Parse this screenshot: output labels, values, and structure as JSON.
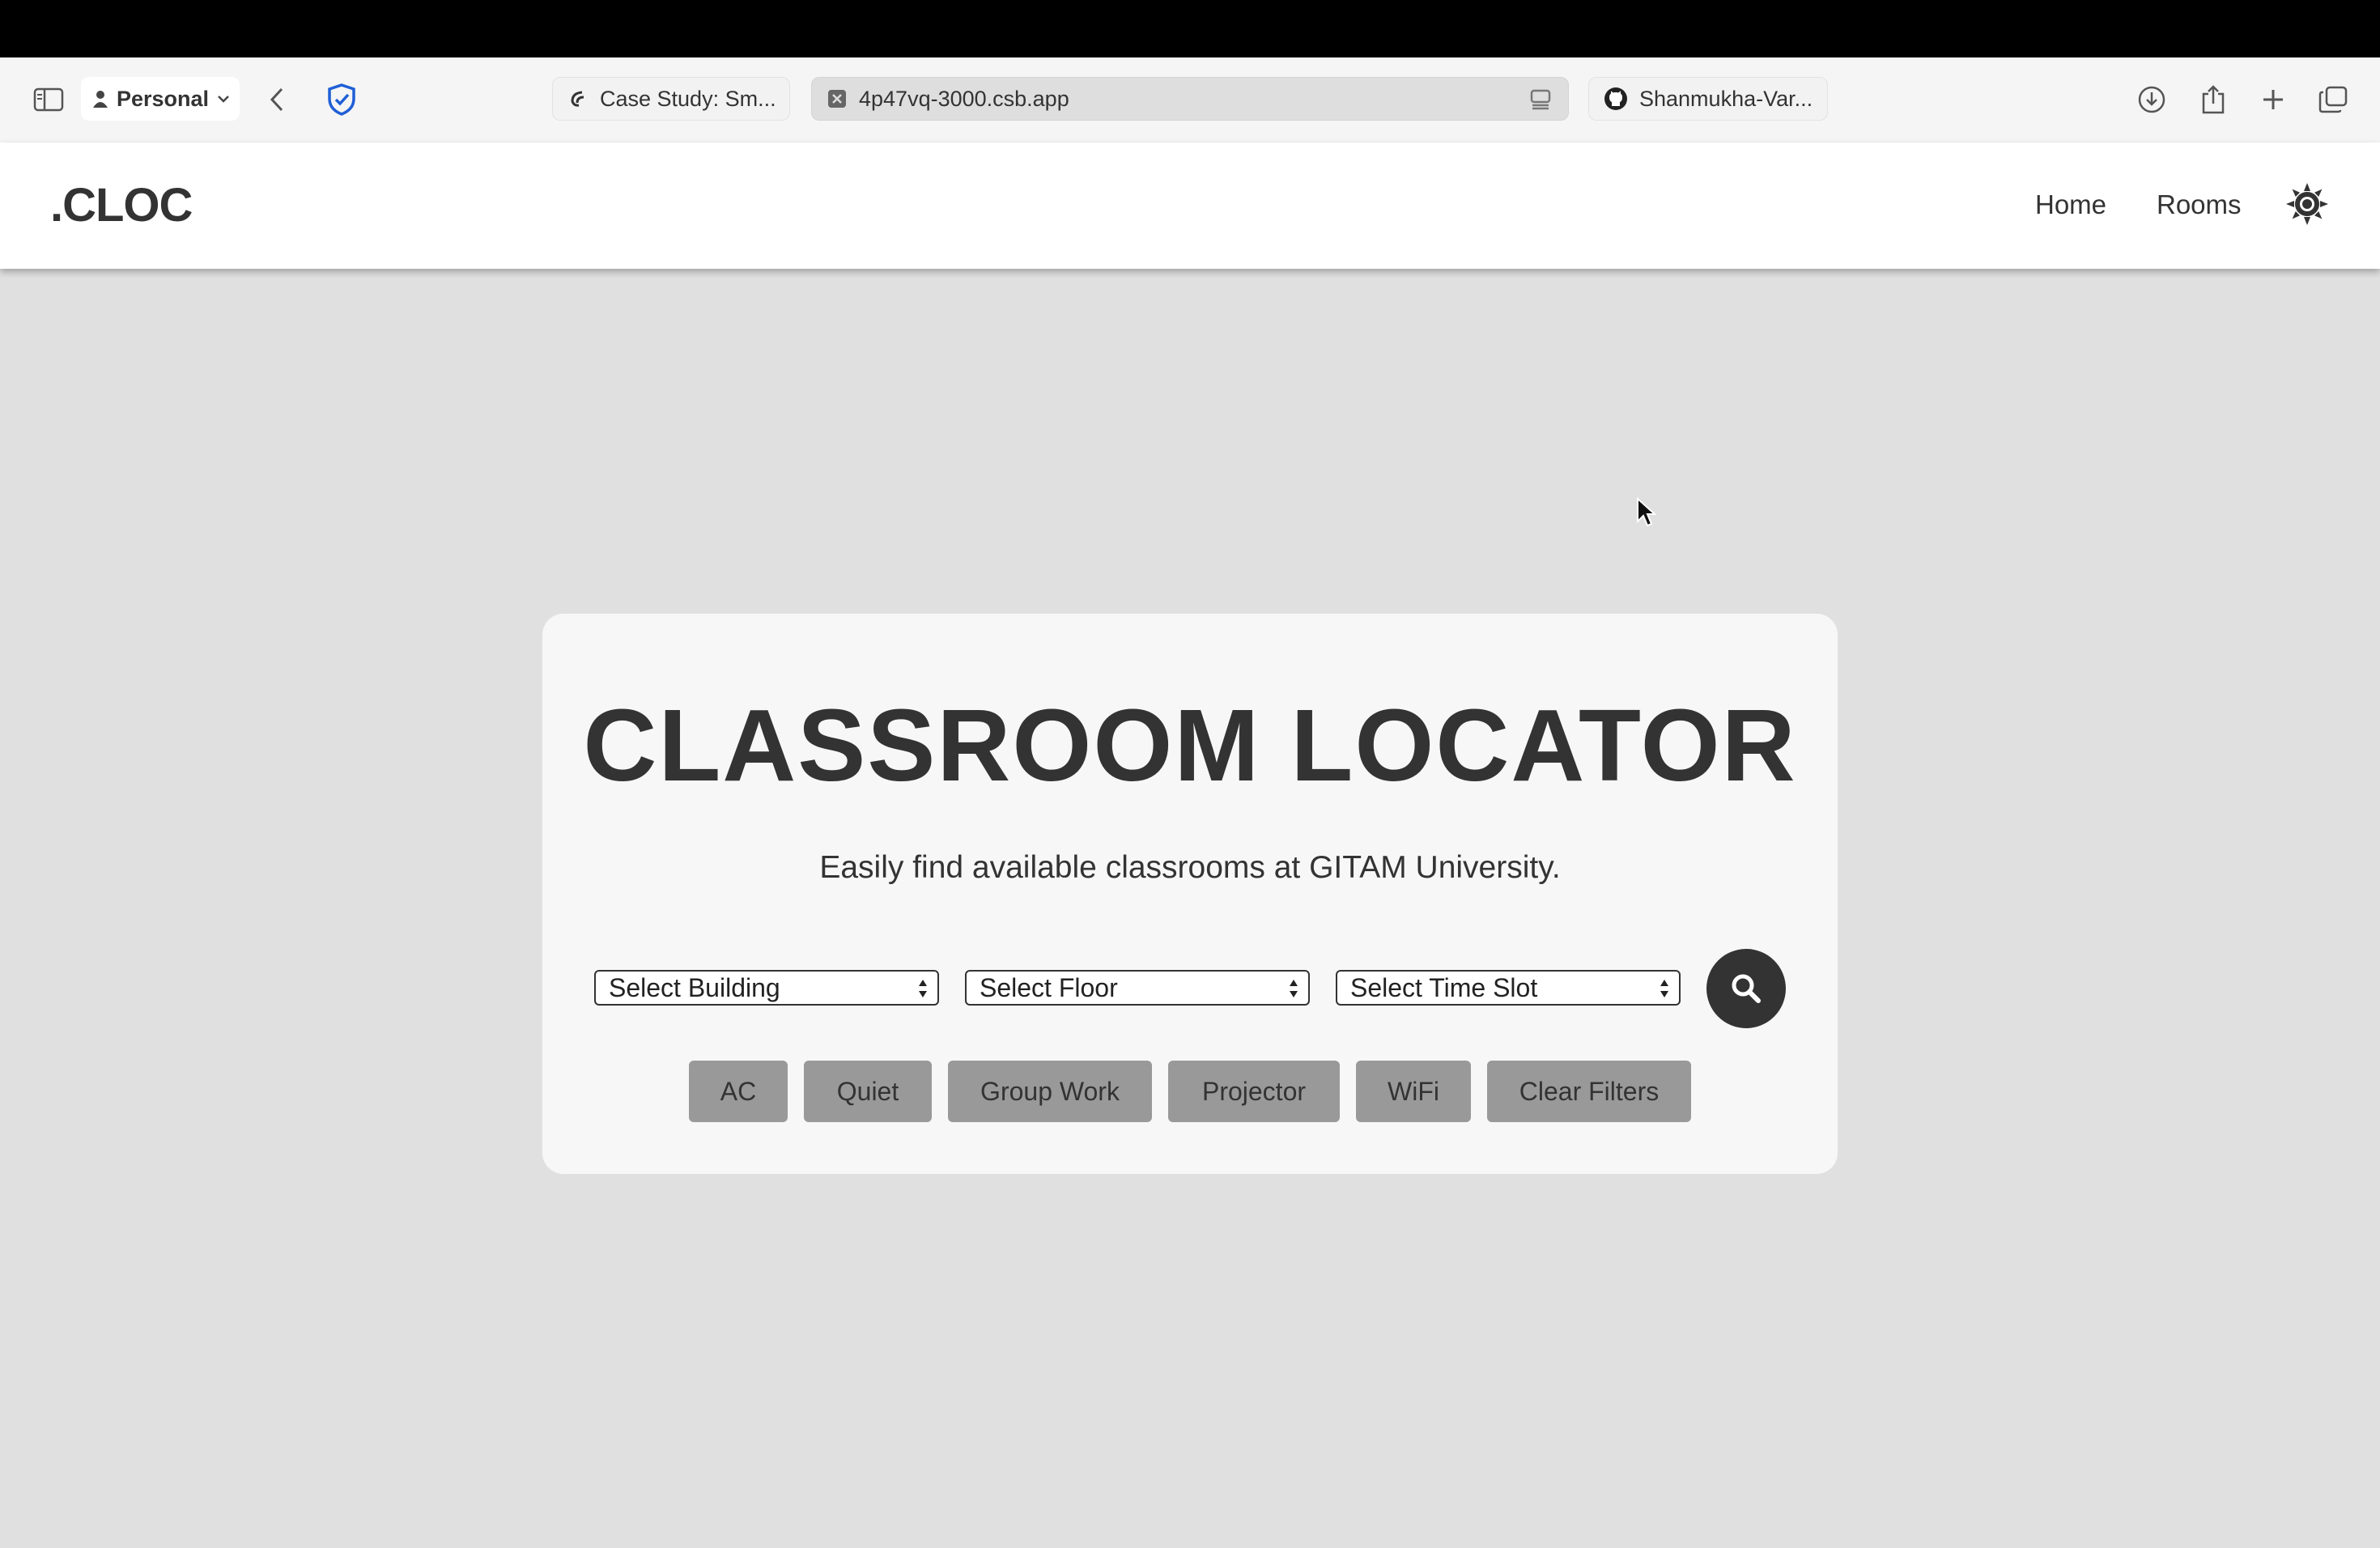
{
  "browser": {
    "profile_label": "Personal",
    "tabs": [
      {
        "label": "Case Study: Sm..."
      },
      {
        "label": "4p47vq-3000.csb.app"
      },
      {
        "label": "Shanmukha-Var..."
      }
    ]
  },
  "site": {
    "logo": ".CLOC",
    "nav": {
      "home": "Home",
      "rooms": "Rooms"
    }
  },
  "hero": {
    "title": "CLASSROOM LOCATOR",
    "subtitle": "Easily find available classrooms at GITAM University."
  },
  "search": {
    "building": "Select Building",
    "floor": "Select Floor",
    "time_slot": "Select Time Slot"
  },
  "filters": {
    "ac": "AC",
    "quiet": "Quiet",
    "group_work": "Group Work",
    "projector": "Projector",
    "wifi": "WiFi",
    "clear": "Clear Filters"
  },
  "icons": {
    "sidebar": "sidebar-icon",
    "back": "back-arrow-icon",
    "shield": "shield-icon",
    "download": "download-icon",
    "share": "share-icon",
    "new_tab": "plus-icon",
    "tabs_overview": "tabs-overview-icon",
    "theme": "sun-icon",
    "search": "search-icon"
  },
  "colors": {
    "page_bg": "#e0e0e0",
    "card_bg": "#f7f7f7",
    "text_dark": "#333333",
    "filter_bg": "#999999",
    "shield_blue": "#1f5fd6"
  }
}
